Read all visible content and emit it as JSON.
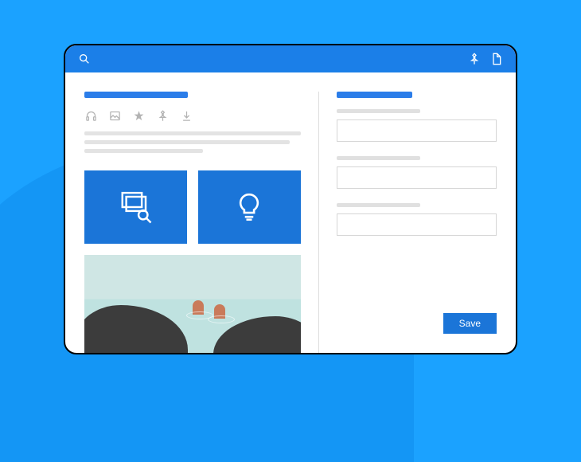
{
  "titlebar": {
    "search_icon": "search",
    "pin_icon": "pin",
    "file_icon": "file"
  },
  "main": {
    "toolbar": {
      "headphones": "headphones",
      "image": "image",
      "star": "star",
      "pin": "pin",
      "download": "download"
    },
    "cards": {
      "gallery_search": "gallery-search",
      "idea": "lightbulb"
    }
  },
  "form": {
    "fields": [
      {
        "label": "",
        "value": ""
      },
      {
        "label": "",
        "value": ""
      },
      {
        "label": "",
        "value": ""
      }
    ],
    "save_label": "Save"
  }
}
